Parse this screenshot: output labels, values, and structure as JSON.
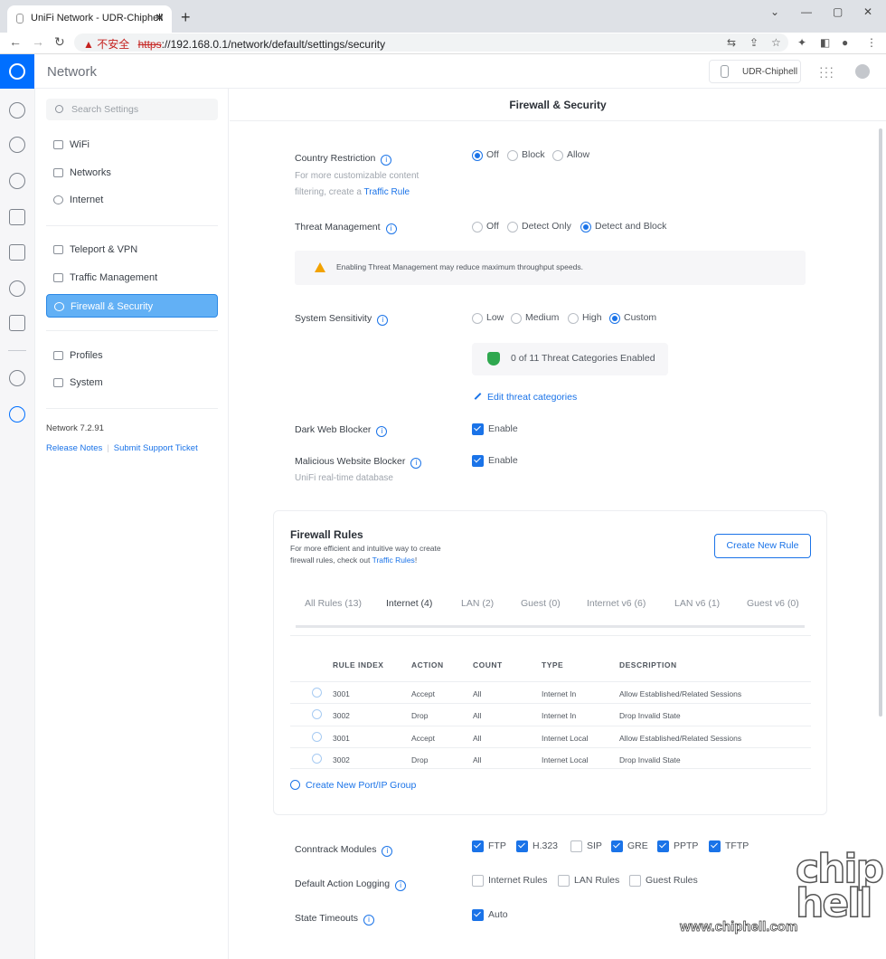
{
  "browser": {
    "tab_title": "UniFi Network - UDR-Chiphell",
    "tab_close": "✕",
    "new_tab": "+",
    "security_warning": "不安全",
    "url_protocol": "https",
    "url_rest": "://192.168.0.1/network/default/settings/security"
  },
  "app": {
    "title": "Network",
    "device_name": "UDR-Chiphell"
  },
  "sidebar": {
    "search_placeholder": "Search Settings",
    "items": [
      {
        "label": "WiFi"
      },
      {
        "label": "Networks"
      },
      {
        "label": "Internet"
      },
      {
        "label": "Teleport & VPN"
      },
      {
        "label": "Traffic Management"
      },
      {
        "label": "Firewall & Security"
      },
      {
        "label": "Profiles"
      },
      {
        "label": "System"
      }
    ],
    "version": "Network 7.2.91",
    "release_notes": "Release Notes",
    "support_ticket": "Submit Support Ticket"
  },
  "page": {
    "title": "Firewall & Security",
    "country_restriction": {
      "label": "Country Restriction",
      "desc_line1": "For more customizable content",
      "desc_line2": "filtering, create a",
      "desc_link": "Traffic Rule",
      "options": [
        "Off",
        "Block",
        "Allow"
      ],
      "selected": "Off"
    },
    "threat_management": {
      "label": "Threat Management",
      "options": [
        "Off",
        "Detect Only",
        "Detect and Block"
      ],
      "selected": "Detect and Block",
      "warning": "Enabling Threat Management may reduce maximum throughput speeds."
    },
    "system_sensitivity": {
      "label": "System Sensitivity",
      "options": [
        "Low",
        "Medium",
        "High",
        "Custom"
      ],
      "selected": "Custom",
      "categories_status": "0 of 11 Threat Categories Enabled",
      "edit_link": "Edit threat categories"
    },
    "dark_web_blocker": {
      "label": "Dark Web Blocker",
      "option": "Enable",
      "checked": true
    },
    "malicious_blocker": {
      "label": "Malicious Website Blocker",
      "option": "Enable",
      "checked": true,
      "sub": "UniFi real-time database"
    },
    "firewall_rules": {
      "title": "Firewall Rules",
      "desc_line1": "For more efficient and intuitive way to create",
      "desc_line2": "firewall rules, check out",
      "desc_link": "Traffic Rules",
      "desc_end": "!",
      "create_button": "Create New Rule",
      "tabs": [
        "All Rules (13)",
        "Internet (4)",
        "LAN (2)",
        "Guest (0)",
        "Internet v6 (6)",
        "LAN v6 (1)",
        "Guest v6 (0)"
      ],
      "active_tab": "Internet (4)",
      "columns": [
        "RULE INDEX",
        "ACTION",
        "COUNT",
        "TYPE",
        "DESCRIPTION"
      ],
      "rows": [
        {
          "index": "3001",
          "action": "Accept",
          "count": "All",
          "type": "Internet In",
          "description": "Allow Established/Related Sessions"
        },
        {
          "index": "3002",
          "action": "Drop",
          "count": "All",
          "type": "Internet In",
          "description": "Drop Invalid State"
        },
        {
          "index": "3001",
          "action": "Accept",
          "count": "All",
          "type": "Internet Local",
          "description": "Allow Established/Related Sessions"
        },
        {
          "index": "3002",
          "action": "Drop",
          "count": "All",
          "type": "Internet Local",
          "description": "Drop Invalid State"
        }
      ],
      "port_group_link": "Create New Port/IP Group"
    },
    "conntrack_modules": {
      "label": "Conntrack Modules",
      "options": [
        {
          "label": "FTP",
          "checked": true
        },
        {
          "label": "H.323",
          "checked": true
        },
        {
          "label": "SIP",
          "checked": false
        },
        {
          "label": "GRE",
          "checked": true
        },
        {
          "label": "PPTP",
          "checked": true
        },
        {
          "label": "TFTP",
          "checked": true
        }
      ]
    },
    "default_action_logging": {
      "label": "Default Action Logging",
      "options": [
        {
          "label": "Internet Rules",
          "checked": false
        },
        {
          "label": "LAN Rules",
          "checked": false
        },
        {
          "label": "Guest Rules",
          "checked": false
        }
      ]
    },
    "state_timeouts": {
      "label": "State Timeouts",
      "option": "Auto",
      "checked": true
    }
  },
  "watermark": {
    "big": "chip\nhell",
    "url": "www.chiphell.com"
  },
  "colors": {
    "accent": "#1a73e8",
    "brand": "#006fff",
    "active_nav": "#62b0f5",
    "warning": "#f2a200",
    "shield": "#2fa84f"
  }
}
